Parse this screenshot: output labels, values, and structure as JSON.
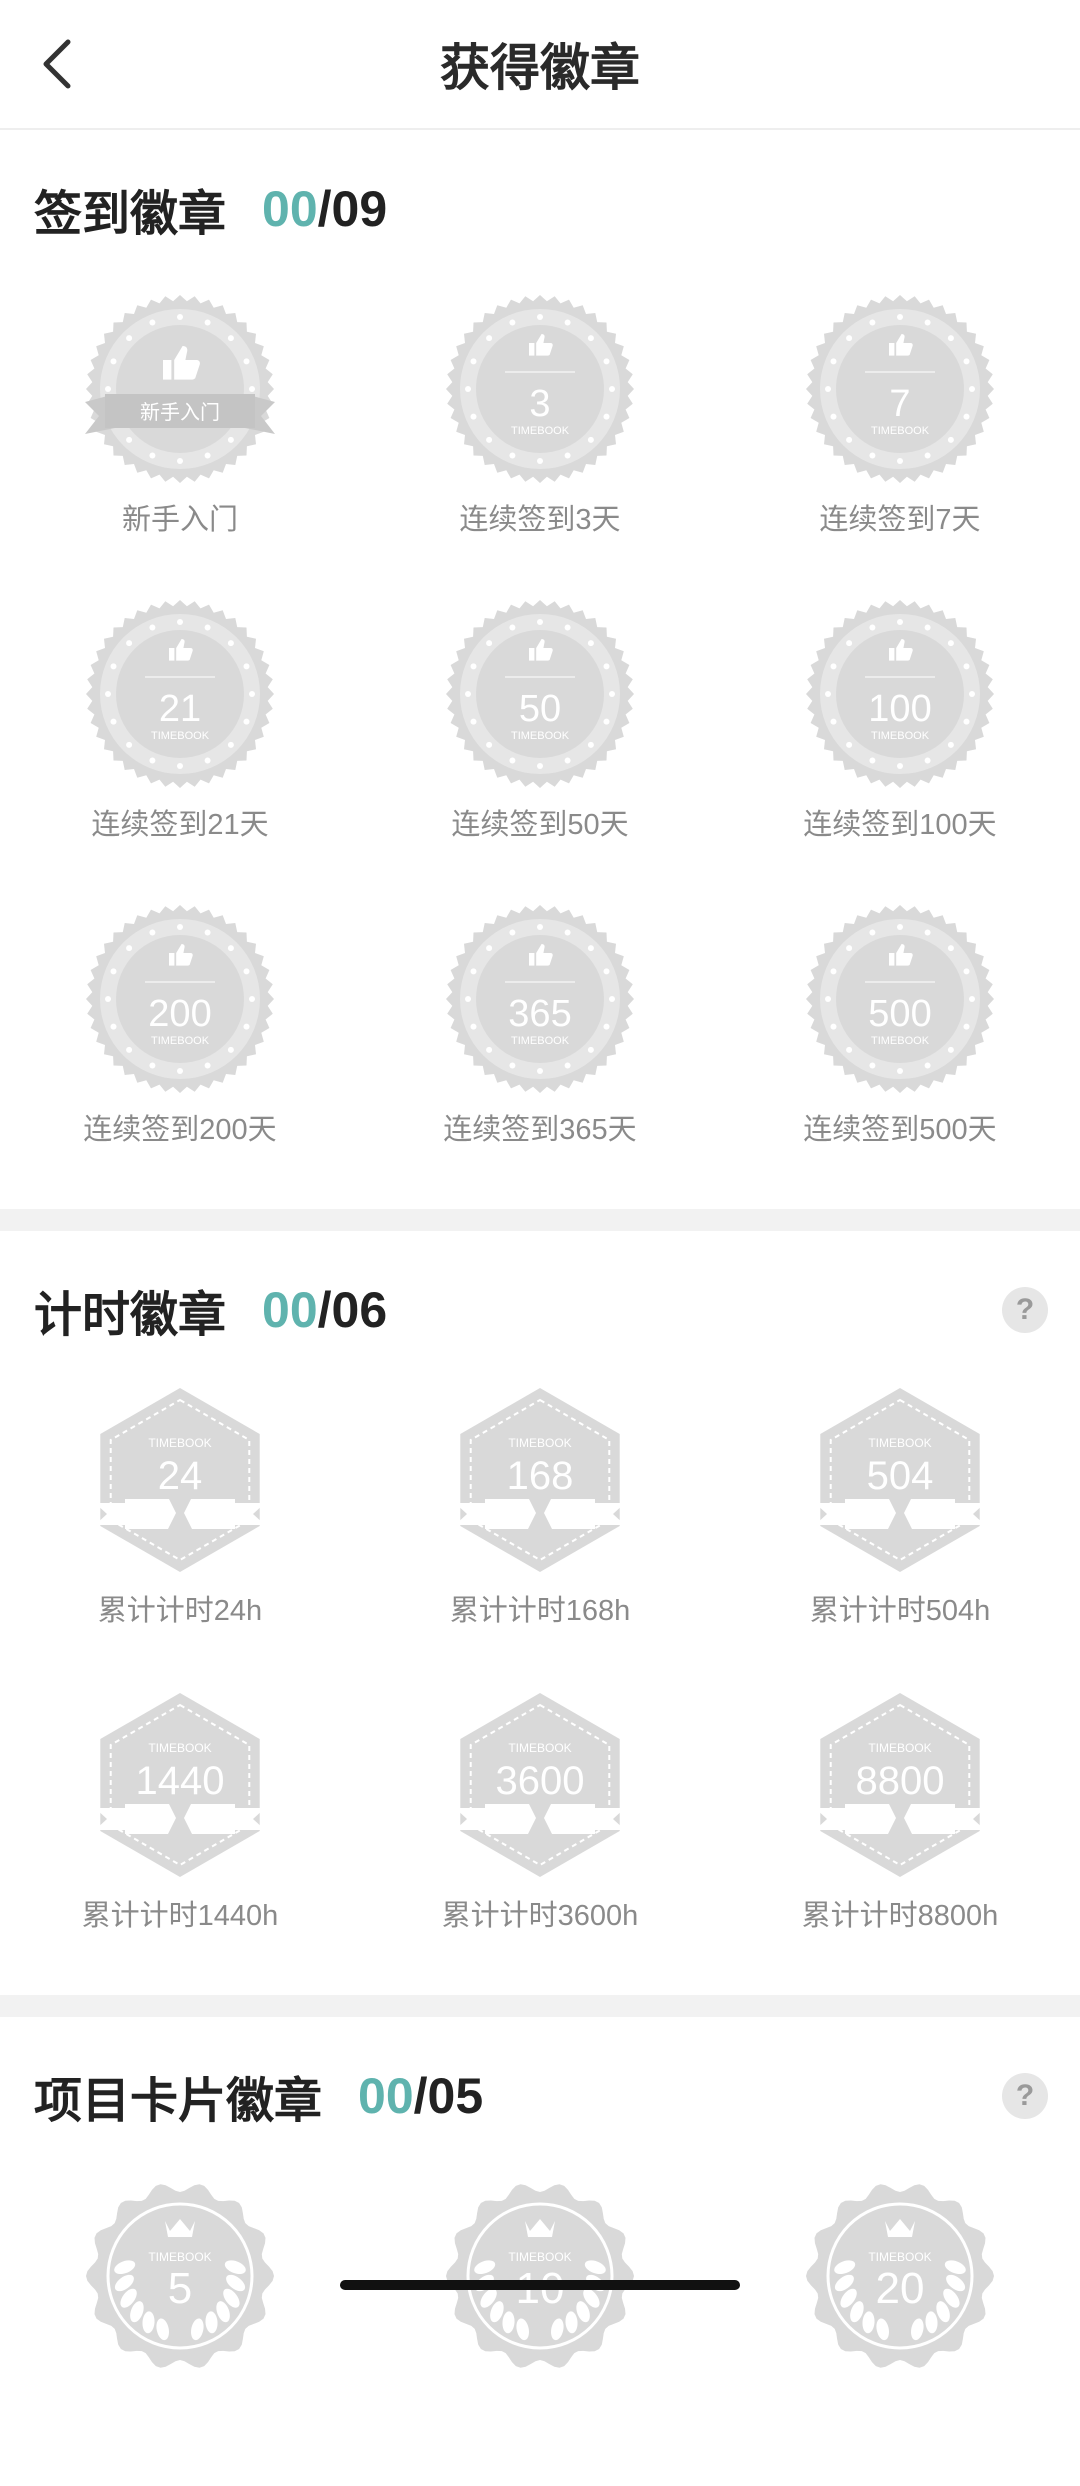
{
  "header": {
    "title": "获得徽章"
  },
  "sections": [
    {
      "title": "签到徽章",
      "count_done": "00",
      "count_total": "/09",
      "help": "",
      "badges": [
        {
          "value": "",
          "ribbon": "新手入门",
          "label": "新手入门"
        },
        {
          "value": "3",
          "label": "连续签到3天"
        },
        {
          "value": "7",
          "label": "连续签到7天"
        },
        {
          "value": "21",
          "label": "连续签到21天"
        },
        {
          "value": "50",
          "label": "连续签到50天"
        },
        {
          "value": "100",
          "label": "连续签到100天"
        },
        {
          "value": "200",
          "label": "连续签到200天"
        },
        {
          "value": "365",
          "label": "连续签到365天"
        },
        {
          "value": "500",
          "label": "连续签到500天"
        }
      ]
    },
    {
      "title": "计时徽章",
      "count_done": "00",
      "count_total": "/06",
      "help": "?",
      "badges": [
        {
          "value": "24",
          "label": "累计计时24h"
        },
        {
          "value": "168",
          "label": "累计计时168h"
        },
        {
          "value": "504",
          "label": "累计计时504h"
        },
        {
          "value": "1440",
          "label": "累计计时1440h"
        },
        {
          "value": "3600",
          "label": "累计计时3600h"
        },
        {
          "value": "8800",
          "label": "累计计时8800h"
        }
      ]
    },
    {
      "title": "项目卡片徽章",
      "count_done": "00",
      "count_total": "/05",
      "help": "?",
      "badges": [
        {
          "value": "5",
          "label": ""
        },
        {
          "value": "10",
          "label": ""
        },
        {
          "value": "20",
          "label": ""
        }
      ]
    }
  ],
  "badge_brand": "TIMEBOOK",
  "colors": {
    "accent": "#5fb3ae",
    "badge_gray": "#d9d9d9",
    "badge_light": "#e6e6e6"
  }
}
